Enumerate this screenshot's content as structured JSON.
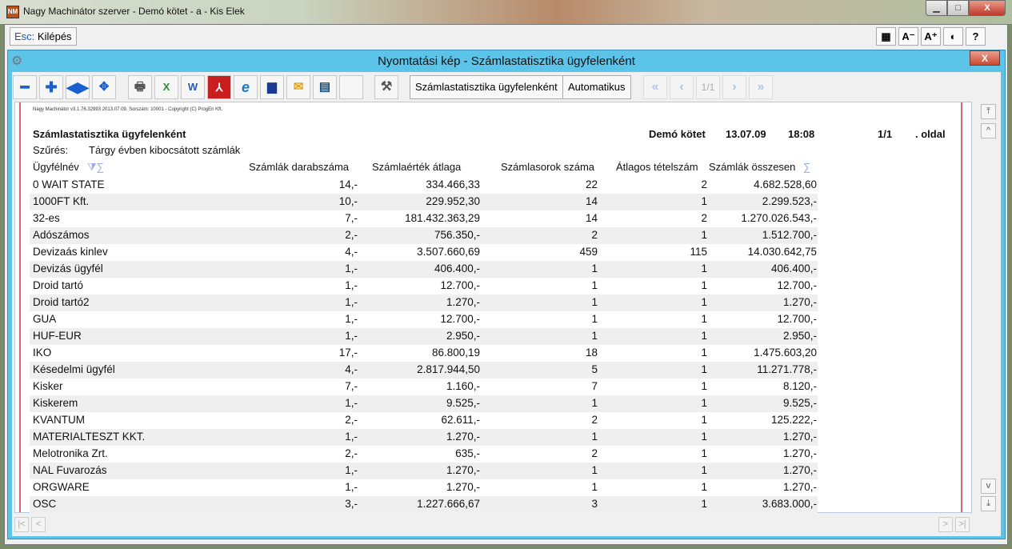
{
  "window": {
    "title": "Nagy Machinátor szerver - Demó kötet - a - Kis Elek",
    "minimize": "▁",
    "maximize": "□",
    "close": "X"
  },
  "topbar": {
    "esc_key": "Esc:",
    "esc_label": "Kilépés",
    "tools": [
      "▦",
      "A⁻",
      "A⁺",
      "◐",
      "?"
    ]
  },
  "dialog": {
    "title": "Nyomtatási kép - Számlastatisztika ügyfelenként",
    "close": "X",
    "toolbar": {
      "report_button": "Számlastatisztika ügyfelenként",
      "auto_button": "Automatikus",
      "page": "1/1",
      "first": "«",
      "prev": "‹",
      "next": "›",
      "last": "»"
    }
  },
  "report": {
    "copyright": "Nagy Machinátor v3.1.76.32993 2013.07.09. Sorszám: 10001 - Copyright (C) ProgEn Kft.",
    "title": "Számlastatisztika ügyfelenként",
    "volume": "Demó kötet",
    "date": "13.07.09",
    "time": "18:08",
    "page": "1/1",
    "page_suffix": ". oldal",
    "filter_label": "Szűrés:",
    "filter_value": "Tárgy évben kibocsátott számlák",
    "columns": [
      "Ügyfélnév",
      "Számlák darabszáma",
      "Számlaérték átlaga",
      "Számlasorok száma",
      "Átlagos tételszám",
      "Számlák összesen"
    ],
    "sigma": "∑",
    "filter_icon": "⧩∑",
    "rows": [
      [
        "0 WAIT STATE",
        "14,-",
        "334.466,33",
        "22",
        "2",
        "4.682.528,60"
      ],
      [
        "1000FT Kft.",
        "10,-",
        "229.952,30",
        "14",
        "1",
        "2.299.523,-"
      ],
      [
        "32-es",
        "7,-",
        "181.432.363,29",
        "14",
        "2",
        "1.270.026.543,-"
      ],
      [
        "Adószámos",
        "2,-",
        "756.350,-",
        "2",
        "1",
        "1.512.700,-"
      ],
      [
        "Devizaás kinlev",
        "4,-",
        "3.507.660,69",
        "459",
        "115",
        "14.030.642,75"
      ],
      [
        "Devizás ügyfél",
        "1,-",
        "406.400,-",
        "1",
        "1",
        "406.400,-"
      ],
      [
        "Droid tartó",
        "1,-",
        "12.700,-",
        "1",
        "1",
        "12.700,-"
      ],
      [
        "Droid tartó2",
        "1,-",
        "1.270,-",
        "1",
        "1",
        "1.270,-"
      ],
      [
        "GUA",
        "1,-",
        "12.700,-",
        "1",
        "1",
        "12.700,-"
      ],
      [
        "HUF-EUR",
        "1,-",
        "2.950,-",
        "1",
        "1",
        "2.950,-"
      ],
      [
        "IKO",
        "17,-",
        "86.800,19",
        "18",
        "1",
        "1.475.603,20"
      ],
      [
        "Késedelmi ügyfél",
        "4,-",
        "2.817.944,50",
        "5",
        "1",
        "11.271.778,-"
      ],
      [
        "Kisker",
        "7,-",
        "1.160,-",
        "7",
        "1",
        "8.120,-"
      ],
      [
        "Kiskerem",
        "1,-",
        "9.525,-",
        "1",
        "1",
        "9.525,-"
      ],
      [
        "KVANTUM",
        "2,-",
        "62.611,-",
        "2",
        "1",
        "125.222,-"
      ],
      [
        "MATERIALTESZT KKT.",
        "1,-",
        "1.270,-",
        "1",
        "1",
        "1.270,-"
      ],
      [
        "Melotronika Zrt.",
        "2,-",
        "635,-",
        "2",
        "1",
        "1.270,-"
      ],
      [
        "NAL Fuvarozás",
        "1,-",
        "1.270,-",
        "1",
        "1",
        "1.270,-"
      ],
      [
        "ORGWARE",
        "1,-",
        "1.270,-",
        "1",
        "1",
        "1.270,-"
      ],
      [
        "OSC",
        "3,-",
        "1.227.666,67",
        "3",
        "1",
        "3.683.000,-"
      ]
    ]
  },
  "scroll": {
    "top": "⤒",
    "up": "^",
    "down": "v",
    "bottom": "⤓",
    "first": "|<",
    "prev": "<",
    "next": ">",
    "last": ">|"
  }
}
